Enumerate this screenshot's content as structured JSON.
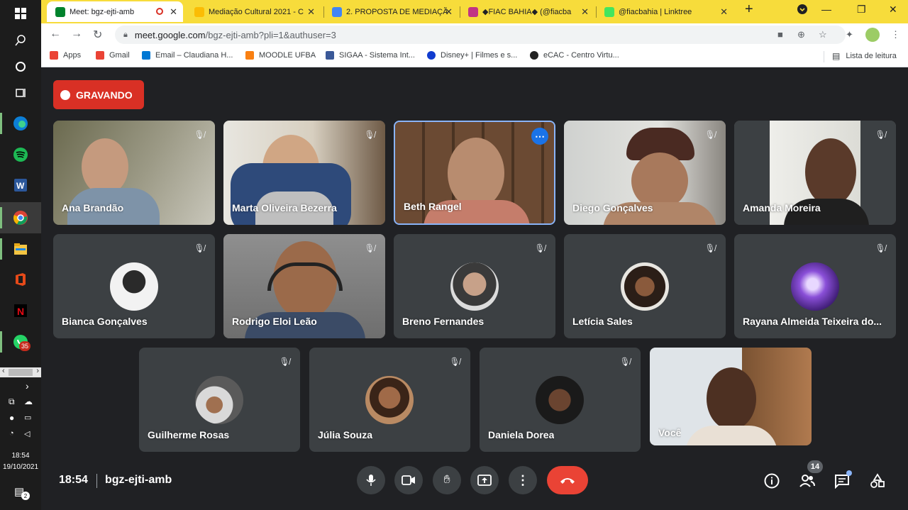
{
  "browser": {
    "tabs": [
      {
        "label": "Meet: bgz-ejti-amb",
        "active": true
      },
      {
        "label": "Mediação Cultural 2021 - C"
      },
      {
        "label": "2. PROPOSTA DE MEDIAÇÃ"
      },
      {
        "label": "◆FIAC BAHIA◆ (@fiacba"
      },
      {
        "label": "@fiacbahia | Linktree"
      }
    ],
    "url_host": "meet.google.com",
    "url_path": "/bgz-ejti-amb?pli=1&authuser=3",
    "bookmarks": [
      {
        "label": "Apps",
        "icon": "apps-grid-icon",
        "color": "#ea4335"
      },
      {
        "label": "Gmail",
        "icon": "gmail-icon",
        "color": "#ea4335"
      },
      {
        "label": "Email – Claudiana H...",
        "icon": "outlook-icon",
        "color": "#0078d4"
      },
      {
        "label": "MOODLE UFBA",
        "icon": "moodle-icon",
        "color": "#f98012"
      },
      {
        "label": "SIGAA - Sistema Int...",
        "icon": "sigaa-icon",
        "color": "#3b5998"
      },
      {
        "label": "Disney+ | Filmes e s...",
        "icon": "disney-icon",
        "color": "#113ccf"
      },
      {
        "label": "eCAC - Centro Virtu...",
        "icon": "ecac-icon",
        "color": "#222222"
      }
    ],
    "reading_list": "Lista de leitura"
  },
  "taskbar": {
    "whatsapp_badge": "35",
    "notification_badge": "2",
    "time": "18:54",
    "date": "19/10/2021"
  },
  "meet": {
    "recording_label": "GRAVANDO",
    "participants": [
      {
        "name": "Ana Brandão",
        "kind": "video"
      },
      {
        "name": "Marta Oliveira Bezerra",
        "kind": "video"
      },
      {
        "name": "Beth Rangel",
        "kind": "video",
        "speaking": true
      },
      {
        "name": "Diego Gonçalves",
        "kind": "video"
      },
      {
        "name": "Amanda Moreira",
        "kind": "video"
      },
      {
        "name": "Bianca Gonçalves",
        "kind": "avatar"
      },
      {
        "name": "Rodrigo Eloi Leão",
        "kind": "video"
      },
      {
        "name": "Breno Fernandes",
        "kind": "avatar"
      },
      {
        "name": "Letícia Sales",
        "kind": "avatar"
      },
      {
        "name": "Rayana Almeida Teixeira do...",
        "kind": "avatar"
      },
      {
        "name": "Guilherme Rosas",
        "kind": "avatar"
      },
      {
        "name": "Júlia Souza",
        "kind": "avatar"
      },
      {
        "name": "Daniela Dorea",
        "kind": "avatar"
      },
      {
        "name": "Você",
        "kind": "video"
      }
    ],
    "time": "18:54",
    "meeting_code": "bgz-ejti-amb",
    "participant_count": "14",
    "colors": {
      "recording": "#d93025",
      "end_call": "#ea4335",
      "speaking_border": "#8ab4f8"
    }
  }
}
